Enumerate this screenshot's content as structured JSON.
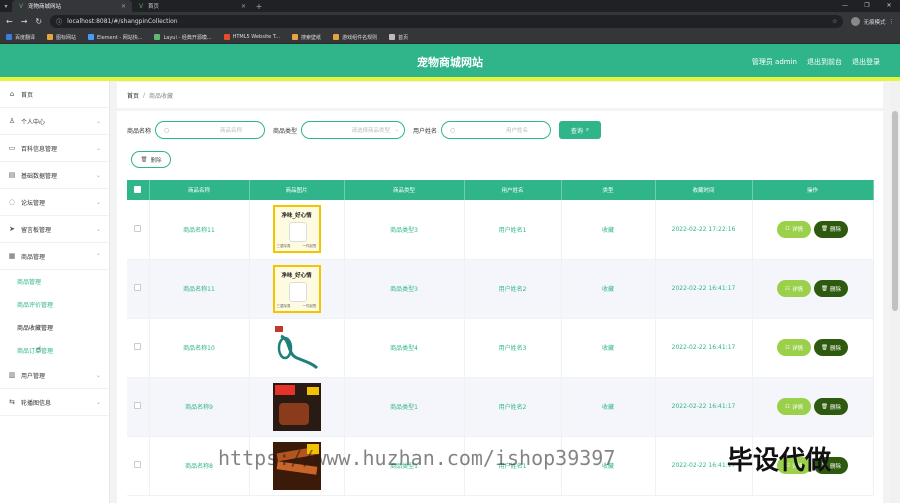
{
  "browser": {
    "tabs": [
      {
        "title": "宠物商城网站",
        "active": true
      },
      {
        "title": "首页",
        "active": false
      }
    ],
    "url": "localhost:8081/#/shangpinCollection",
    "profile": "无痕模式",
    "bookmarks": [
      "百度翻译",
      "图标网站",
      "Element - 网站快...",
      "Layui - 经典开源模...",
      "HTML5 Website T...",
      "搜索壁纸",
      "游戏组件名规则",
      "首页"
    ]
  },
  "header": {
    "title": "宠物商城网站",
    "admin": "管理员 admin",
    "back": "退出到前台",
    "logout": "退出登录"
  },
  "sidebar": {
    "items": [
      {
        "label": "首页",
        "icon": "home-icon"
      },
      {
        "label": "个人中心",
        "icon": "user-icon"
      },
      {
        "label": "百科信息管理",
        "icon": "book-icon"
      },
      {
        "label": "基础数据管理",
        "icon": "data-icon"
      },
      {
        "label": "论坛管理",
        "icon": "forum-icon"
      },
      {
        "label": "留言板管理",
        "icon": "message-icon"
      },
      {
        "label": "商品管理",
        "icon": "goods-icon"
      }
    ],
    "sub": [
      "商品管理",
      "商品评价管理",
      "商品收藏管理",
      "商品订单管理"
    ],
    "after": [
      {
        "label": "用户管理",
        "icon": "users-icon"
      },
      {
        "label": "轮播图信息",
        "icon": "carousel-icon"
      }
    ]
  },
  "breadcrumb": {
    "home": "首页",
    "sep": "/",
    "current": "商品收藏"
  },
  "search": {
    "name_label": "商品名称",
    "name_ph": "商品名称",
    "type_label": "商品类型",
    "type_ph": "请选择商品类型",
    "user_label": "用户姓名",
    "user_ph": "用户姓名",
    "query": "查询"
  },
  "actions": {
    "delete": "删除",
    "detail": "详情"
  },
  "table": {
    "headers": [
      "商品名称",
      "商品图片",
      "商品类型",
      "用户姓名",
      "类型",
      "收藏时间",
      "操作"
    ],
    "rows": [
      {
        "name": "商品名称11",
        "img": "roll",
        "type": "商品类型3",
        "user": "用户姓名1",
        "kind": "收藏",
        "time": "2022-02-22 17:22:16"
      },
      {
        "name": "商品名称11",
        "img": "roll",
        "type": "商品类型3",
        "user": "用户姓名2",
        "kind": "收藏",
        "time": "2022-02-22 16:41:17"
      },
      {
        "name": "商品名称10",
        "img": "leash",
        "type": "商品类型4",
        "user": "用户姓名3",
        "kind": "收藏",
        "time": "2022-02-22 16:41:17"
      },
      {
        "name": "商品名称9",
        "img": "dark",
        "type": "商品类型1",
        "user": "用户姓名2",
        "kind": "收藏",
        "time": "2022-02-22 16:41:17"
      },
      {
        "name": "商品名称8",
        "img": "jerky",
        "type": "商品类型1",
        "user": "用户姓名1",
        "kind": "收藏",
        "time": "2022-02-22 16:41:17"
      }
    ],
    "roll_caption": "净味_好心情",
    "roll_left": "三重除臭",
    "roll_right": "一件起售"
  },
  "watermark": {
    "url": "https://www.huzhan.com/ishop39397",
    "text": "毕设代做"
  },
  "colors": {
    "primary": "#2fb589",
    "accent": "#e6f43d",
    "detail": "#9ad04a",
    "delete": "#2e5a0f"
  }
}
